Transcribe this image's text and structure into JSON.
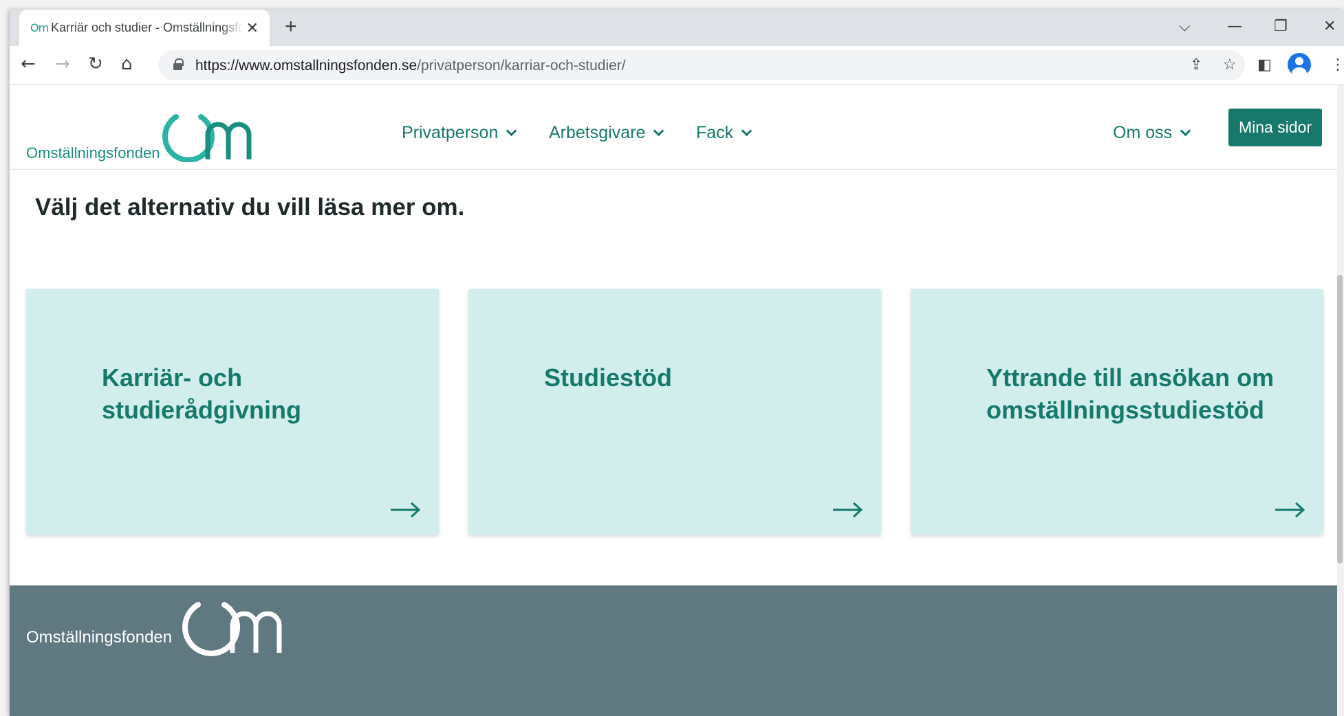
{
  "browser": {
    "tab_title": "Karriär och studier - Omställningsfonden",
    "favicon_text": "Om",
    "new_tab_label": "+",
    "url_domain": "https://www.omstallningsfonden.se",
    "url_path": "/privatperson/karriar-och-studier/"
  },
  "site": {
    "logo_text": "Omställningsfonden",
    "nav": [
      {
        "label": "Privatperson"
      },
      {
        "label": "Arbetsgivare"
      },
      {
        "label": "Fack"
      },
      {
        "label": "Om oss"
      }
    ],
    "mina_sidor": "Mina sidor"
  },
  "main": {
    "heading": "Välj det alternativ du vill läsa mer om.",
    "cards": [
      {
        "title": "Karriär- och studierådgivning"
      },
      {
        "title": "Studiestöd"
      },
      {
        "title": "Yttrande till ansökan om omställningsstudiestöd"
      }
    ]
  },
  "footer": {
    "logo_text": "Omställningsfonden"
  },
  "colors": {
    "brand_teal": "#16796b",
    "card_bg": "#d2eeec",
    "footer_bg": "#607880"
  }
}
